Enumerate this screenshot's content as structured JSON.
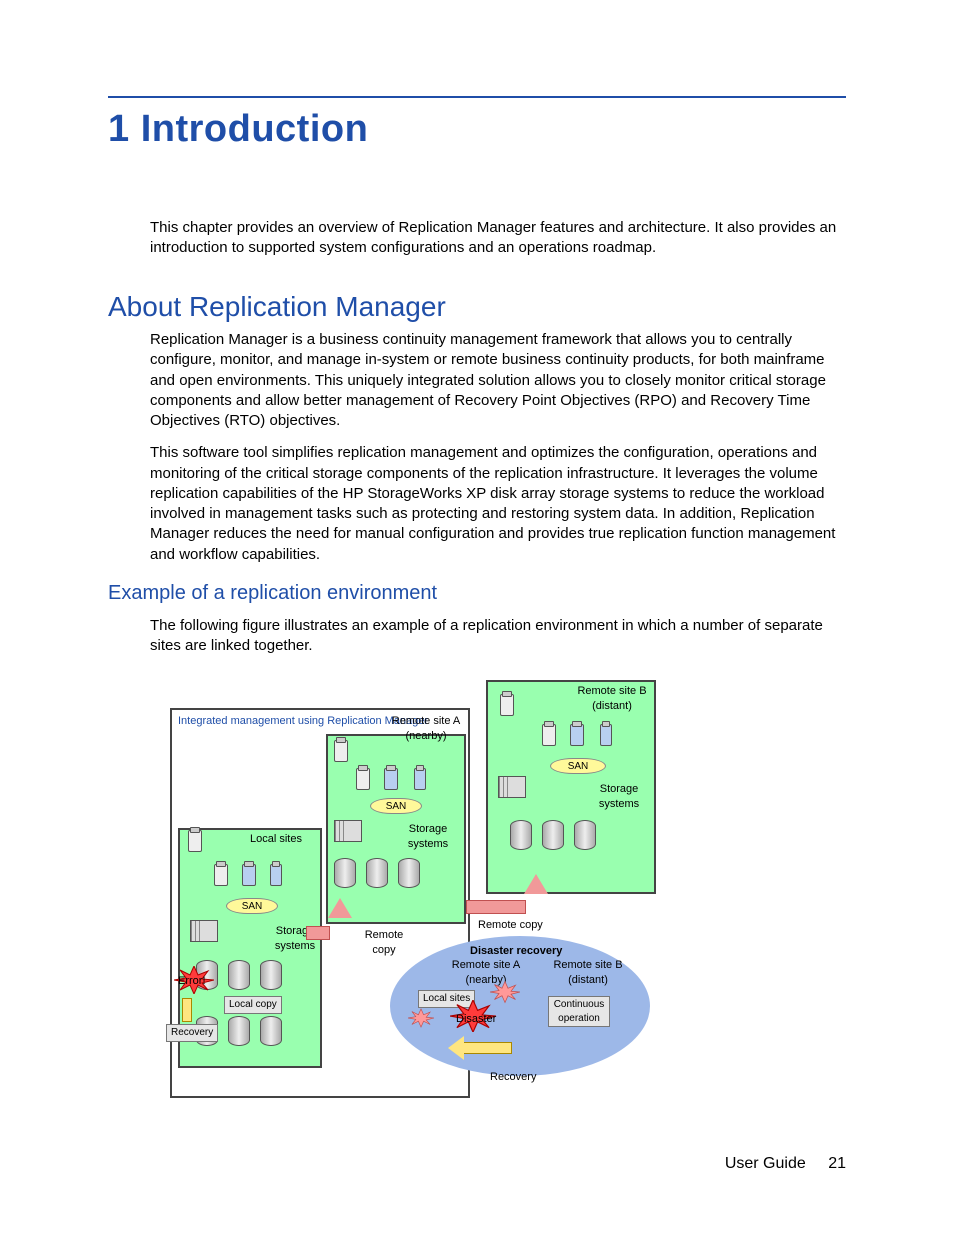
{
  "chapter": {
    "number": "1",
    "title": "Introduction"
  },
  "intro": "This chapter provides an overview of Replication Manager features and architecture. It also provides an introduction to supported system configurations and an operations roadmap.",
  "about": {
    "heading": "About Replication Manager",
    "p1": "Replication Manager is a business continuity management framework that allows you to centrally configure, monitor, and manage in-system or remote business continuity products, for both mainframe and open environments. This uniquely integrated solution allows you to closely monitor critical storage components and allow better management of Recovery Point Objectives (RPO) and Recovery Time Objectives (RTO) objectives.",
    "p2": "This software tool simplifies replication management and optimizes the configuration, operations and monitoring of the critical storage components of the replication infrastructure. It leverages the volume replication capabilities of the HP StorageWorks XP disk array storage systems to reduce the workload involved in management tasks such as protecting and restoring system data. In addition, Replication Manager reduces the need for manual configuration and provides true replication function management and workflow capabilities."
  },
  "example": {
    "heading": "Example of a replication environment",
    "p": "The following figure illustrates an example of a replication environment in which a number of separate sites are linked together."
  },
  "figure": {
    "title": "Integrated management using Replication Manager",
    "local_sites": "Local sites",
    "remote_a": "Remote site A",
    "remote_a_sub": "(nearby)",
    "remote_b": "Remote site B",
    "remote_b_sub": "(distant)",
    "san": "SAN",
    "storage_systems": "Storage systems",
    "remote_copy": "Remote copy",
    "local_copy": "Local copy",
    "error": "Error!",
    "recovery": "Recovery",
    "disaster_recovery_title": "Disaster recovery",
    "dr_local": "Local sites",
    "dr_remote_a": "Remote site A",
    "dr_remote_a_sub": "(nearby)",
    "dr_remote_b": "Remote site B",
    "dr_remote_b_sub": "(distant)",
    "disaster": "Disaster",
    "continuous": "Continuous operation"
  },
  "footer": {
    "doc": "User Guide",
    "page": "21"
  }
}
